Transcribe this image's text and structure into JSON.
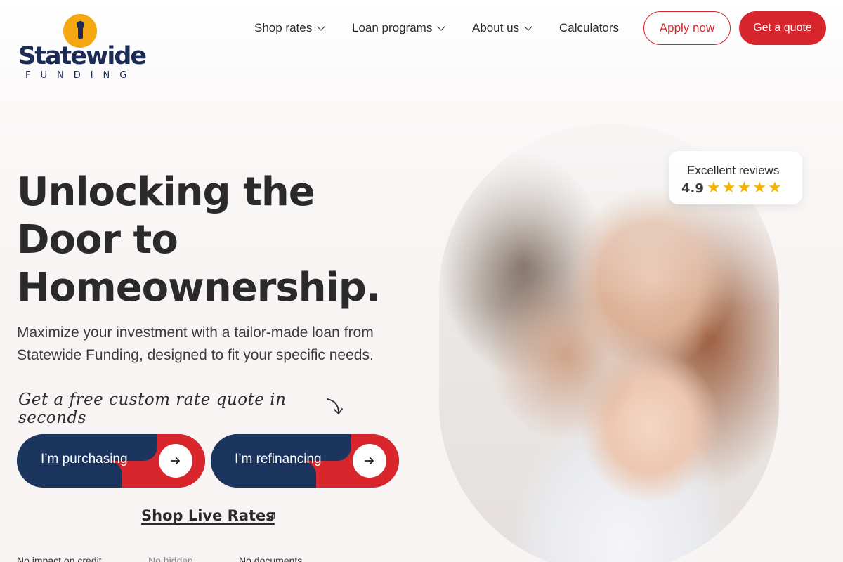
{
  "brand": {
    "name": "Statewide",
    "sub": "FUNDING"
  },
  "nav": {
    "items": [
      {
        "label": "Shop rates"
      },
      {
        "label": "Loan programs"
      },
      {
        "label": "About us"
      },
      {
        "label": "Calculators"
      }
    ],
    "apply_label": "Apply now",
    "quote_label": "Get a quote"
  },
  "hero": {
    "title_lines": [
      "Unlocking the",
      "Door to",
      "Homeownership."
    ],
    "subtitle_lines": [
      "Maximize your investment with a tailor-made loan from",
      "Statewide Funding, designed to fit your specific needs."
    ],
    "script_line": "Get a free custom rate quote in seconds",
    "cta": [
      {
        "label": "I’m purchasing"
      },
      {
        "label": "I’m refinancing"
      }
    ],
    "shop_live_label": "Shop Live Rates",
    "footnotes": [
      "No impact on credit",
      "No hidden",
      "No documents"
    ]
  },
  "reviews": {
    "title": "Excellent reviews",
    "score": "4.9",
    "stars": 5
  },
  "colors": {
    "brand_navy": "#1c355e",
    "brand_red": "#d9262c",
    "brand_gold": "#f5a712",
    "star": "#f5b301"
  },
  "icons": {
    "nav_chevron": "chevron-down-icon",
    "cta_arrow": "arrow-right-icon",
    "shop_arrow": "arrow-up-right-icon",
    "logo_key": "keyhole-icon"
  }
}
